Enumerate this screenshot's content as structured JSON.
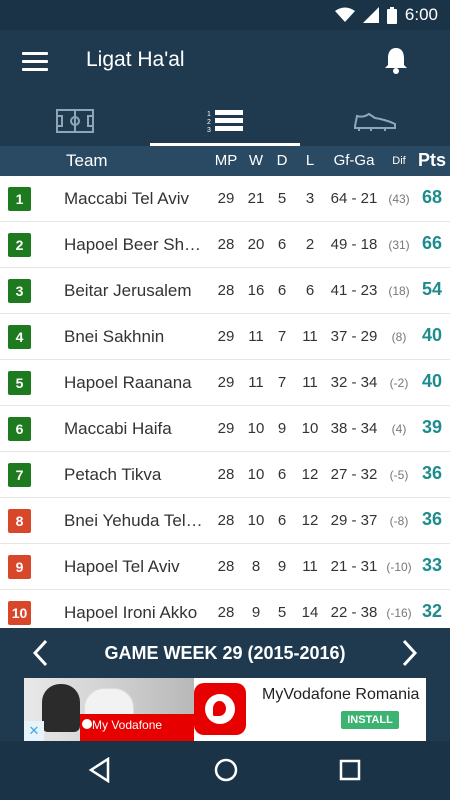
{
  "status_bar": {
    "time": "6:00"
  },
  "app_bar": {
    "title": "Ligat Ha'al"
  },
  "tabs": [
    {
      "icon": "field-icon"
    },
    {
      "icon": "standings-list-icon"
    },
    {
      "icon": "football-boot-icon"
    }
  ],
  "table_header": {
    "team": "Team",
    "mp": "MP",
    "w": "W",
    "d": "D",
    "l": "L",
    "gfga": "Gf-Ga",
    "dif": "Dif",
    "pts": "Pts"
  },
  "standings": [
    {
      "pos": "1",
      "team": "Maccabi Tel Aviv",
      "mp": "29",
      "w": "21",
      "d": "5",
      "l": "3",
      "gfga": "64 - 21",
      "dif": "(43)",
      "pts": "68",
      "color": "#1e7a1e"
    },
    {
      "pos": "2",
      "team": "Hapoel Beer Sheva",
      "mp": "28",
      "w": "20",
      "d": "6",
      "l": "2",
      "gfga": "49 - 18",
      "dif": "(31)",
      "pts": "66",
      "color": "#1e7a1e"
    },
    {
      "pos": "3",
      "team": "Beitar Jerusalem",
      "mp": "28",
      "w": "16",
      "d": "6",
      "l": "6",
      "gfga": "41 - 23",
      "dif": "(18)",
      "pts": "54",
      "color": "#1e7a1e"
    },
    {
      "pos": "4",
      "team": "Bnei Sakhnin",
      "mp": "29",
      "w": "11",
      "d": "7",
      "l": "11",
      "gfga": "37 - 29",
      "dif": "(8)",
      "pts": "40",
      "color": "#1e7a1e"
    },
    {
      "pos": "5",
      "team": "Hapoel Raanana",
      "mp": "29",
      "w": "11",
      "d": "7",
      "l": "11",
      "gfga": "32 - 34",
      "dif": "(-2)",
      "pts": "40",
      "color": "#1e7a1e"
    },
    {
      "pos": "6",
      "team": "Maccabi Haifa",
      "mp": "29",
      "w": "10",
      "d": "9",
      "l": "10",
      "gfga": "38 - 34",
      "dif": "(4)",
      "pts": "39",
      "color": "#1e7a1e"
    },
    {
      "pos": "7",
      "team": "Petach Tikva",
      "mp": "28",
      "w": "10",
      "d": "6",
      "l": "12",
      "gfga": "27 - 32",
      "dif": "(-5)",
      "pts": "36",
      "color": "#1e7a1e"
    },
    {
      "pos": "8",
      "team": "Bnei Yehuda Tel Aviv",
      "mp": "28",
      "w": "10",
      "d": "6",
      "l": "12",
      "gfga": "29 - 37",
      "dif": "(-8)",
      "pts": "36",
      "color": "#d9472b"
    },
    {
      "pos": "9",
      "team": "Hapoel Tel Aviv",
      "mp": "28",
      "w": "8",
      "d": "9",
      "l": "11",
      "gfga": "21 - 31",
      "dif": "(-10)",
      "pts": "33",
      "color": "#d9472b"
    },
    {
      "pos": "10",
      "team": "Hapoel Ironi Akko",
      "mp": "28",
      "w": "9",
      "d": "5",
      "l": "14",
      "gfga": "22 - 38",
      "dif": "(-16)",
      "pts": "32",
      "color": "#d9472b"
    }
  ],
  "week_bar": {
    "title": "GAME WEEK 29 (2015-2016)"
  },
  "ad": {
    "brand_small": "My Vodafone",
    "title": "MyVodafone Romania",
    "install": "INSTALL"
  }
}
